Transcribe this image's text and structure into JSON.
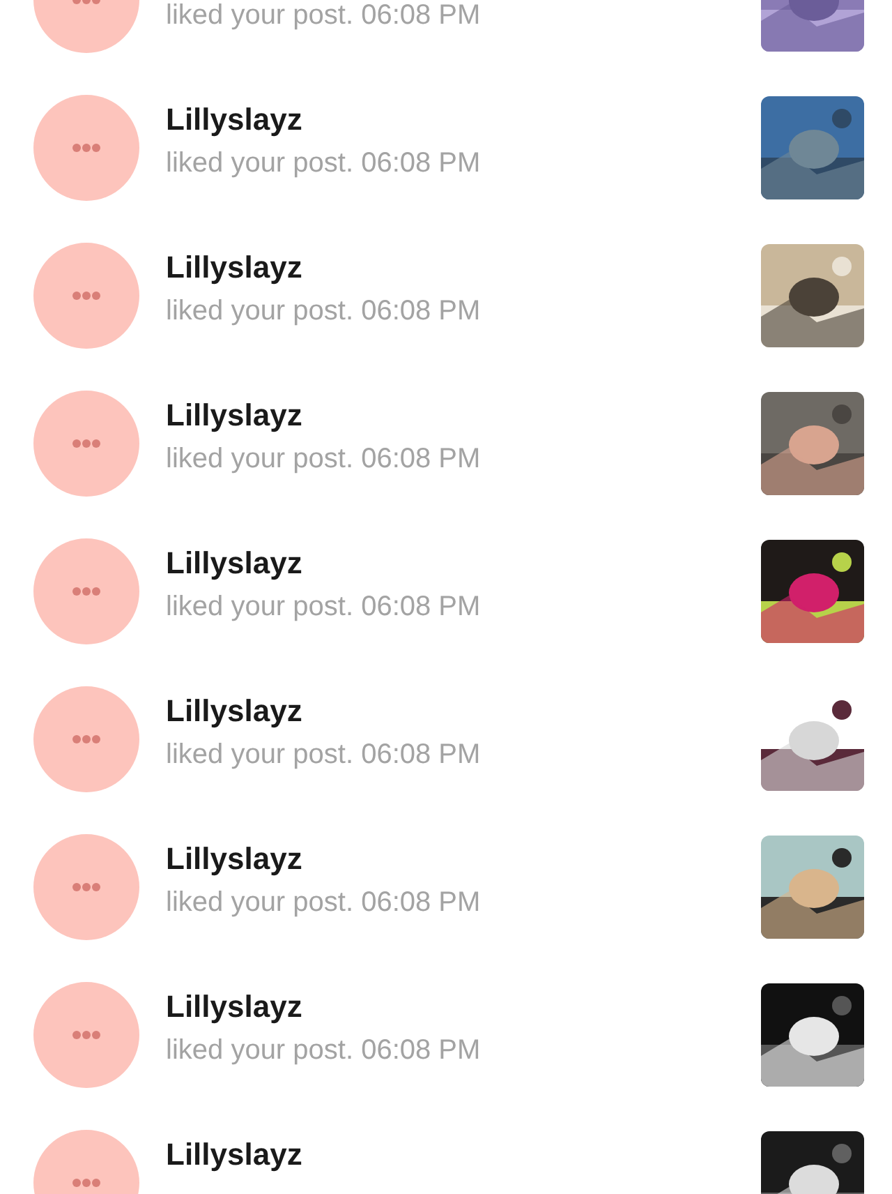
{
  "notifications": [
    {
      "message": "liked your post. 06:08 PM"
    },
    {
      "name": "Lillyslayz",
      "message": "liked your post. 06:08 PM"
    },
    {
      "name": "Lillyslayz",
      "message": "liked your post. 06:08 PM"
    },
    {
      "name": "Lillyslayz",
      "message": "liked your post. 06:08 PM"
    },
    {
      "name": "Lillyslayz",
      "message": "liked your post. 06:08 PM"
    },
    {
      "name": "Lillyslayz",
      "message": "liked your post. 06:08 PM"
    },
    {
      "name": "Lillyslayz",
      "message": "liked your post. 06:08 PM"
    },
    {
      "name": "Lillyslayz",
      "message": "liked your post. 06:08 PM"
    },
    {
      "name": "Lillyslayz"
    }
  ]
}
